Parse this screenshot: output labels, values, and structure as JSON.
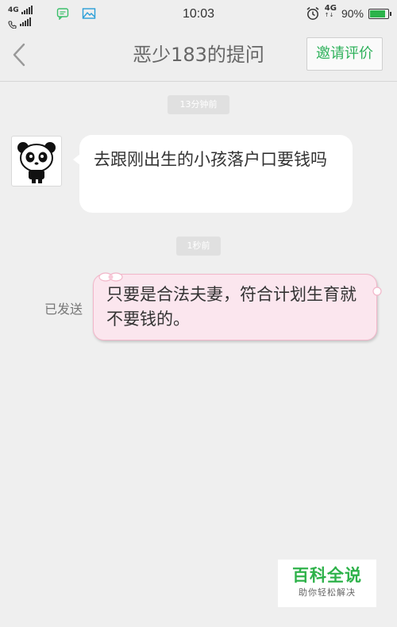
{
  "status_bar": {
    "network_1": "4G",
    "time": "10:03",
    "network_right": "4G",
    "battery_percent": "90%",
    "battery_level": 0.9,
    "icons": [
      "signal-icon",
      "call-icon",
      "message-icon",
      "gallery-icon",
      "alarm-icon",
      "battery-icon"
    ]
  },
  "header": {
    "title": "恶少183的提问",
    "invite_label": "邀请评价"
  },
  "chat": {
    "time_1": "13分钟前",
    "incoming_message": "去跟刚出生的小孩落户口要钱吗",
    "time_2": "1秒前",
    "sent_status": "已发送",
    "outgoing_message": "只要是合法夫妻，符合计划生育就不要钱的。"
  },
  "watermark": {
    "title": "百科全说",
    "subtitle": "助你轻松解决"
  },
  "colors": {
    "accent_green": "#2db15a",
    "outgoing_bubble": "#fbe6ee",
    "outgoing_border": "#f2b6c9"
  }
}
